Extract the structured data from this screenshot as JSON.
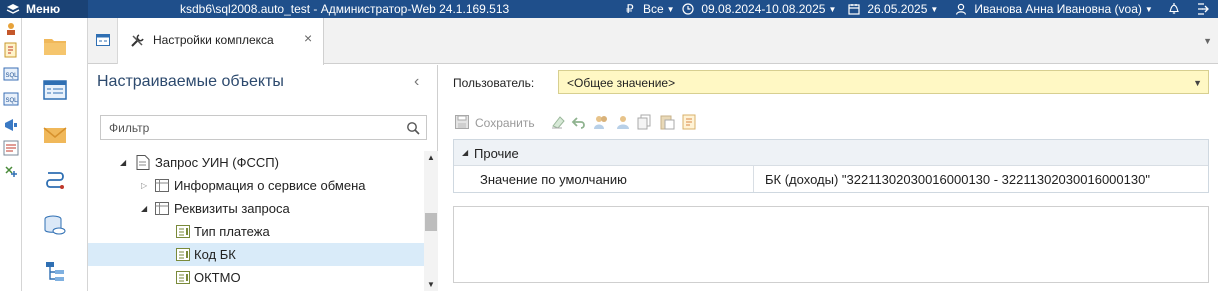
{
  "titlebar": {
    "menu_label": "Меню",
    "connection": "ksdb6\\sql2008.auto_test - Администратор-Web 24.1.169.513",
    "currency_icon": "₽",
    "currency_label": "Все",
    "period_label": "09.08.2024-10.08.2025",
    "date_label": "26.05.2025",
    "user_label": "Иванова Анна Ивановна (voa)"
  },
  "tabs": {
    "active_label": "Настройки комплекса",
    "close_glyph": "×"
  },
  "left_panel": {
    "title": "Настраиваемые объекты",
    "collapse_glyph": "‹",
    "filter_placeholder": "Фильтр",
    "tree": [
      {
        "label": "Запрос УИН (ФССП)",
        "expanded": true
      },
      {
        "label": "Информация о сервисе обмена",
        "expanded": false
      },
      {
        "label": "Реквизиты запроса",
        "expanded": true
      },
      {
        "label": "Тип платежа"
      },
      {
        "label": "Код БК",
        "selected": true
      },
      {
        "label": "ОКТМО"
      }
    ]
  },
  "right_panel": {
    "user_label": "Пользователь:",
    "user_value": "<Общее значение>",
    "save_label": "Сохранить",
    "category_label": "Прочие",
    "property_name": "Значение по умолчанию",
    "property_value": "БК (доходы) \"32211302030016000130 - 32211302030016000130\""
  },
  "colors": {
    "titlebar_bg": "#1f4f8b",
    "selection_bg": "#d9ebf9",
    "user_select_bg": "#fff8c4"
  }
}
